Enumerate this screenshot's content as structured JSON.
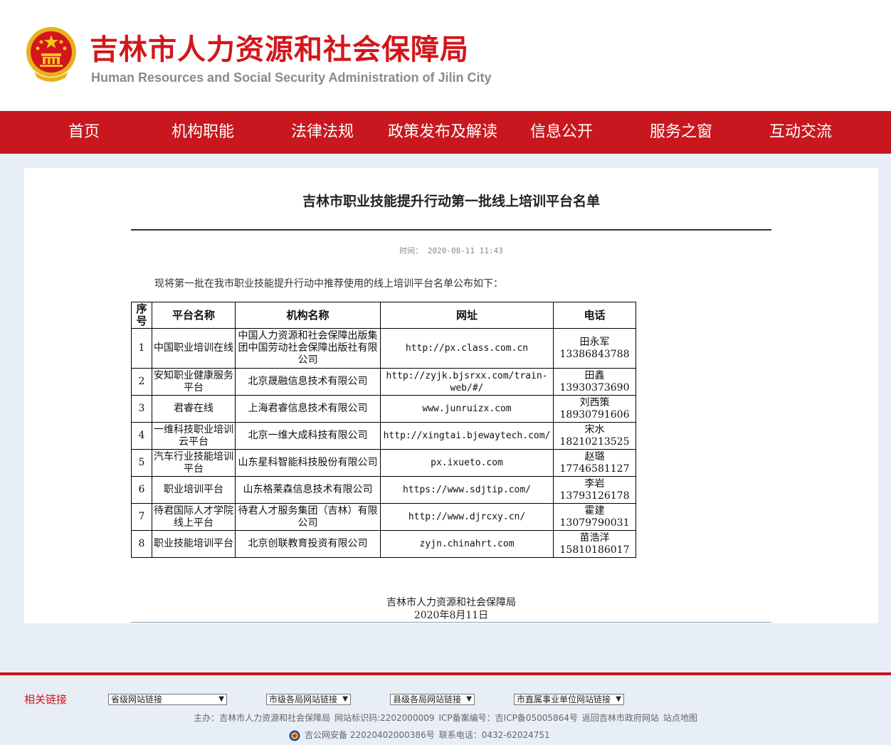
{
  "header": {
    "title": "吉林市人力资源和社会保障局",
    "subtitle": "Human Resources and Social Security Administration of Jilin City"
  },
  "nav": {
    "items": [
      {
        "label": "首页"
      },
      {
        "label": "机构职能"
      },
      {
        "label": "法律法规"
      },
      {
        "label": "政策发布及解读"
      },
      {
        "label": "信息公开"
      },
      {
        "label": "服务之窗"
      },
      {
        "label": "互动交流"
      }
    ]
  },
  "article": {
    "title": "吉林市职业技能提升行动第一批线上培训平台名单",
    "time_label": "时间：",
    "time_value": "2020-08-11 11:43",
    "intro": "现将第一批在我市职业技能提升行动中推荐使用的线上培训平台名单公布如下：",
    "table": {
      "headers": [
        "序号",
        "平台名称",
        "机构名称",
        "网址",
        "电话"
      ],
      "rows": [
        {
          "no": "1",
          "platform": "中国职业培训在线",
          "org": "中国人力资源和社会保障出版集团中国劳动社会保障出版社有限公司",
          "url": "http://px.class.com.cn",
          "contact": "田永军",
          "phone": "13386843788"
        },
        {
          "no": "2",
          "platform": "安知职业健康服务平台",
          "org": "北京晟融信息技术有限公司",
          "url": "http://zyjk.bjsrxx.com/train-web/#/",
          "contact": "田鑫",
          "phone": "13930373690"
        },
        {
          "no": "3",
          "platform": "君睿在线",
          "org": "上海君睿信息技术有限公司",
          "url": "www.junruizx.com",
          "contact": "刘西策",
          "phone": "18930791606"
        },
        {
          "no": "4",
          "platform": "一维科技职业培训云平台",
          "org": "北京一维大成科技有限公司",
          "url": "http://xingtai.bjewaytech.com/",
          "contact": "宋水",
          "phone": "18210213525"
        },
        {
          "no": "5",
          "platform": "汽车行业技能培训平台",
          "org": "山东星科智能科技股份有限公司",
          "url": "px.ixueto.com",
          "contact": "赵璐",
          "phone": "17746581127"
        },
        {
          "no": "6",
          "platform": "职业培训平台",
          "org": "山东格莱森信息技术有限公司",
          "url": "https://www.sdjtip.com/",
          "contact": "李岩",
          "phone": "13793126178"
        },
        {
          "no": "7",
          "platform": "待君国际人才学院线上平台",
          "org": "待君人才服务集团（吉林）有限公司",
          "url": "http://www.djrcxy.cn/",
          "contact": "霍建",
          "phone": "13079790031"
        },
        {
          "no": "8",
          "platform": "职业技能培训平台",
          "org": "北京创联教育投资有限公司",
          "url": "zyjn.chinahrt.com",
          "contact": "苗浩洋",
          "phone": "15810186017"
        }
      ]
    },
    "signature_org": "吉林市人力资源和社会保障局",
    "signature_date": "2020年8月11日"
  },
  "footer": {
    "related_label": "相关链接",
    "selects": [
      {
        "label": "省级网站链接"
      },
      {
        "label": "市级各局网站链接"
      },
      {
        "label": "县级各局网站链接"
      },
      {
        "label": "市直属事业单位网站链接"
      }
    ],
    "host": "主办：吉林市人力资源和社会保障局",
    "site_id": "网站标识码:2202000009",
    "icp": "ICP备案编号：吉ICP备05005864号",
    "gov_link": "返回吉林市政府网站",
    "sitemap": "站点地图",
    "police": "吉公网安备 22020402000386号",
    "phone": "联系电话：0432-62024751"
  },
  "colors": {
    "brand_red": "#c8171e",
    "background": "#e8eef5"
  }
}
